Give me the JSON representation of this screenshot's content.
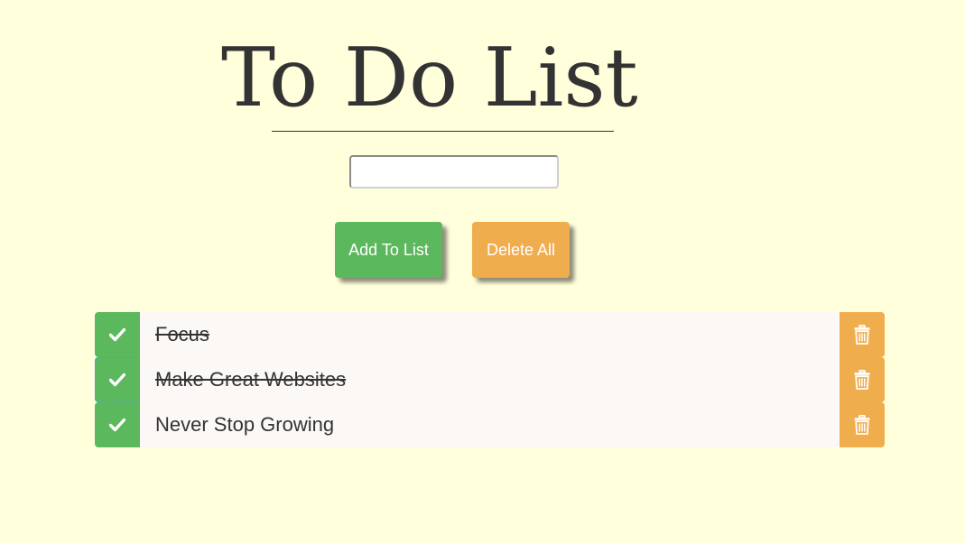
{
  "app": {
    "title": "To Do List"
  },
  "input": {
    "value": "",
    "placeholder": ""
  },
  "buttons": {
    "add_label": "Add To List",
    "delete_all_label": "Delete All"
  },
  "todos": [
    {
      "text": "Focus",
      "completed": true
    },
    {
      "text": "Make Great Websites",
      "completed": true
    },
    {
      "text": "Never Stop Growing",
      "completed": false
    }
  ],
  "icons": {
    "complete": "check-icon",
    "remove": "trash-icon"
  },
  "colors": {
    "background": "#ffffdc",
    "success": "#5cb85c",
    "warning": "#f0ad4e",
    "item_background": "#fcf8f6",
    "text": "#333333"
  }
}
